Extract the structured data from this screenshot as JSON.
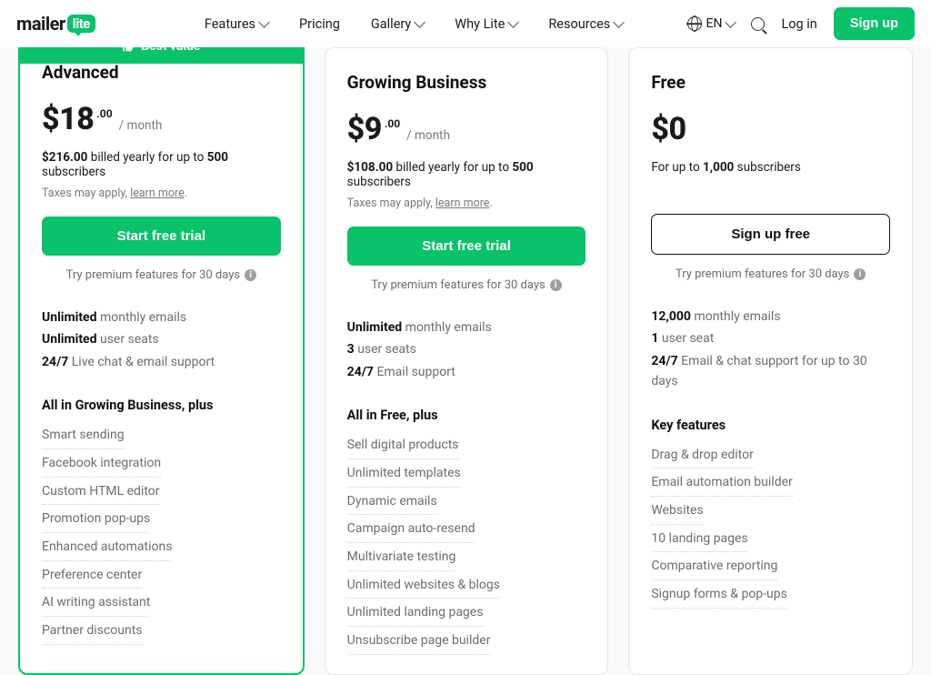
{
  "header": {
    "logo_text": "mailer",
    "logo_badge": "lite",
    "nav": [
      "Features",
      "Pricing",
      "Gallery",
      "Why Lite",
      "Resources"
    ],
    "lang": "EN",
    "login": "Log in",
    "signup": "Sign up"
  },
  "ribbon_label": "Best value",
  "try_text": "Try premium features for 30 days",
  "tax_text": "Taxes may apply, ",
  "tax_link": "learn more",
  "plans": [
    {
      "name": "Advanced",
      "amount": "$18",
      "cents": ".00",
      "per": "/ month",
      "bill_pre": "$216.00",
      "bill_mid": " billed yearly for up to ",
      "bill_n": "500",
      "bill_post": " subscribers",
      "cta": "Start free trial",
      "cta_style": "g",
      "limits": [
        [
          "Unlimited",
          " monthly emails"
        ],
        [
          "Unlimited",
          " user seats"
        ],
        [
          "24/7",
          " Live chat & email support"
        ]
      ],
      "section": "All in Growing Business, plus",
      "feats": [
        "Smart sending",
        "Facebook integration",
        "Custom HTML editor",
        "Promotion pop-ups",
        "Enhanced automations",
        "Preference center",
        "AI writing assistant",
        "Partner discounts"
      ]
    },
    {
      "name": "Growing Business",
      "amount": "$9",
      "cents": ".00",
      "per": "/ month",
      "bill_pre": "$108.00",
      "bill_mid": " billed yearly for up to ",
      "bill_n": "500",
      "bill_post": " subscribers",
      "cta": "Start free trial",
      "cta_style": "g",
      "limits": [
        [
          "Unlimited",
          " monthly emails"
        ],
        [
          "3",
          " user seats"
        ],
        [
          "24/7",
          " Email support"
        ]
      ],
      "section": "All in Free, plus",
      "feats": [
        "Sell digital products",
        "Unlimited templates",
        "Dynamic emails",
        "Campaign auto-resend",
        "Multivariate testing",
        "Unlimited websites & blogs",
        "Unlimited landing pages",
        "Unsubscribe page builder"
      ]
    },
    {
      "name": "Free",
      "amount": "$0",
      "cents": "",
      "per": "",
      "free_line_pre": "For up to ",
      "free_line_n": "1,000",
      "free_line_post": " subscribers",
      "cta": "Sign up free",
      "cta_style": "o",
      "limits": [
        [
          "12,000",
          " monthly emails"
        ],
        [
          "1",
          " user seat"
        ],
        [
          "24/7",
          " Email & chat support for up to 30 days"
        ]
      ],
      "section": "Key features",
      "feats": [
        "Drag & drop editor",
        "Email automation builder",
        "Websites",
        "10 landing pages",
        "Comparative reporting",
        "Signup forms & pop-ups"
      ]
    }
  ]
}
